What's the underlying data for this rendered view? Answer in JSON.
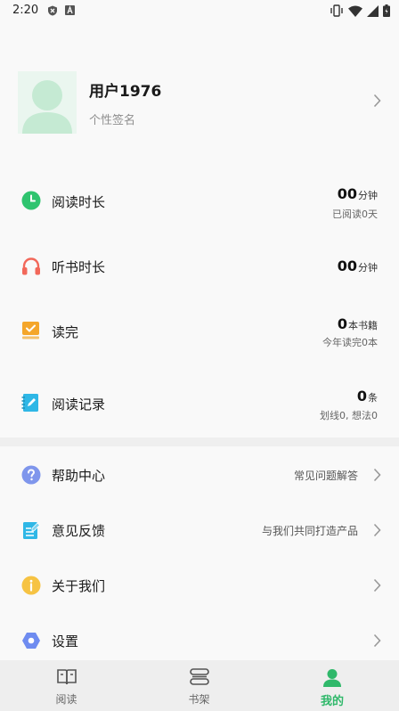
{
  "status_bar": {
    "time": "2:20"
  },
  "profile": {
    "username": "用户1976",
    "signature": "个性签名"
  },
  "stats": [
    {
      "label": "阅读时长",
      "value": "00",
      "unit": "分钟",
      "sub": "已阅读0天",
      "icon": "clock-icon",
      "color": "#2fc46f"
    },
    {
      "label": "听书时长",
      "value": "00",
      "unit": "分钟",
      "sub": "",
      "icon": "headphones-icon",
      "color": "#f2685a"
    },
    {
      "label": "读完",
      "value": "0",
      "unit": "本书籍",
      "sub": "今年读完0本",
      "icon": "book-check-icon",
      "color": "#f4a62a"
    },
    {
      "label": "阅读记录",
      "value": "0",
      "unit": "条",
      "sub": "划线0, 想法0",
      "icon": "notebook-pen-icon",
      "color": "#2fb7e6"
    }
  ],
  "menu": [
    {
      "label": "帮助中心",
      "hint": "常见问题解答",
      "icon": "help-icon",
      "color": "#7f96ec"
    },
    {
      "label": "意见反馈",
      "hint": "与我们共同打造产品",
      "icon": "feedback-icon",
      "color": "#2fb7e6"
    },
    {
      "label": "关于我们",
      "hint": "",
      "icon": "info-icon",
      "color": "#f6c343"
    },
    {
      "label": "设置",
      "hint": "",
      "icon": "settings-icon",
      "color": "#6f8cf0"
    }
  ],
  "bottom_nav": [
    {
      "label": "阅读",
      "icon": "open-book-icon",
      "active": false
    },
    {
      "label": "书架",
      "icon": "bookshelf-icon",
      "active": false
    },
    {
      "label": "我的",
      "icon": "person-icon",
      "active": true
    }
  ],
  "colors": {
    "accent": "#2fb86a",
    "avatar_bg": "#eaf6ef",
    "avatar_fg": "#c5ead3"
  }
}
